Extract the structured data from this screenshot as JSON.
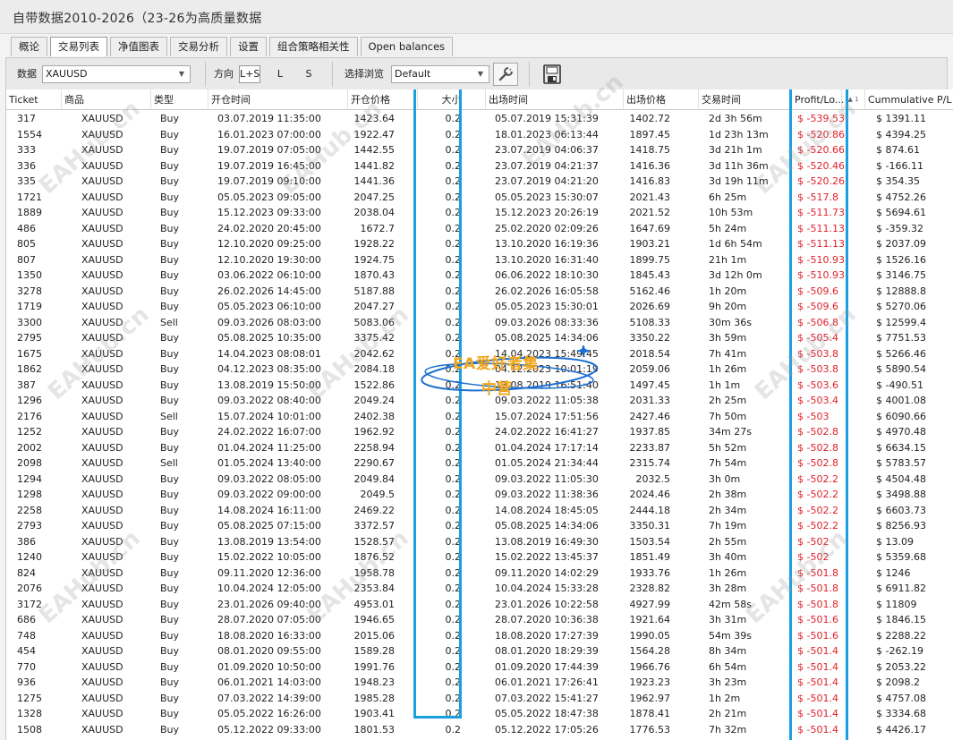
{
  "window": {
    "title": "自带数据2010-2026（23-26为高质量数据"
  },
  "tabs": [
    "概论",
    "交易列表",
    "净值图表",
    "交易分析",
    "设置",
    "组合策略相关性",
    "Open balances"
  ],
  "active_tab": "交易列表",
  "toolbar": {
    "data_label": "数据",
    "symbol_value": "XAUUSD",
    "direction_label": "方向",
    "direction_options": [
      "L+S",
      "L",
      "S"
    ],
    "direction_selected": "L+S",
    "browse_label": "选择浏览",
    "browse_value": "Default",
    "tool_icon": "wrench-icon",
    "export_icon": "csv-export-icon"
  },
  "table": {
    "headers": [
      "Ticket",
      "商品",
      "类型",
      "开仓时间",
      "开仓价格",
      "大小",
      "出场时间",
      "出场价格",
      "交易时间",
      "Profit/Lo...",
      "Cummulative P/L"
    ],
    "sort_marker": "▲ 1",
    "rows": [
      [
        "317",
        "XAUUSD",
        "Buy",
        "03.07.2019 11:35:00",
        "1423.64",
        "0.2",
        "05.07.2019 15:31:39",
        "1402.72",
        "2d 3h 56m",
        "$ -539.53",
        "$ 1391.11"
      ],
      [
        "1554",
        "XAUUSD",
        "Buy",
        "16.01.2023 07:00:00",
        "1922.47",
        "0.2",
        "18.01.2023 06:13:44",
        "1897.45",
        "1d 23h 13m",
        "$ -520.86",
        "$ 4394.25"
      ],
      [
        "333",
        "XAUUSD",
        "Buy",
        "19.07.2019 07:05:00",
        "1442.55",
        "0.2",
        "23.07.2019 04:06:37",
        "1418.75",
        "3d 21h 1m",
        "$ -520.66",
        "$ 874.61"
      ],
      [
        "336",
        "XAUUSD",
        "Buy",
        "19.07.2019 16:45:00",
        "1441.82",
        "0.2",
        "23.07.2019 04:21:37",
        "1416.36",
        "3d 11h 36m",
        "$ -520.46",
        "$ -166.11"
      ],
      [
        "335",
        "XAUUSD",
        "Buy",
        "19.07.2019 09:10:00",
        "1441.36",
        "0.2",
        "23.07.2019 04:21:20",
        "1416.83",
        "3d 19h 11m",
        "$ -520.26",
        "$ 354.35"
      ],
      [
        "1721",
        "XAUUSD",
        "Buy",
        "05.05.2023 09:05:00",
        "2047.25",
        "0.2",
        "05.05.2023 15:30:07",
        "2021.43",
        "6h 25m",
        "$ -517.8",
        "$ 4752.26"
      ],
      [
        "1889",
        "XAUUSD",
        "Buy",
        "15.12.2023 09:33:00",
        "2038.04",
        "0.2",
        "15.12.2023 20:26:19",
        "2021.52",
        "10h 53m",
        "$ -511.73",
        "$ 5694.61"
      ],
      [
        "486",
        "XAUUSD",
        "Buy",
        "24.02.2020 20:45:00",
        "1672.7",
        "0.2",
        "25.02.2020 02:09:26",
        "1647.69",
        "5h 24m",
        "$ -511.13",
        "$ -359.32"
      ],
      [
        "805",
        "XAUUSD",
        "Buy",
        "12.10.2020 09:25:00",
        "1928.22",
        "0.2",
        "13.10.2020 16:19:36",
        "1903.21",
        "1d 6h 54m",
        "$ -511.13",
        "$ 2037.09"
      ],
      [
        "807",
        "XAUUSD",
        "Buy",
        "12.10.2020 19:30:00",
        "1924.75",
        "0.2",
        "13.10.2020 16:31:40",
        "1899.75",
        "21h 1m",
        "$ -510.93",
        "$ 1526.16"
      ],
      [
        "1350",
        "XAUUSD",
        "Buy",
        "03.06.2022 06:10:00",
        "1870.43",
        "0.2",
        "06.06.2022 18:10:30",
        "1845.43",
        "3d 12h 0m",
        "$ -510.93",
        "$ 3146.75"
      ],
      [
        "3278",
        "XAUUSD",
        "Buy",
        "26.02.2026 14:45:00",
        "5187.88",
        "0.2",
        "26.02.2026 16:05:58",
        "5162.46",
        "1h 20m",
        "$ -509.6",
        "$ 12888.8"
      ],
      [
        "1719",
        "XAUUSD",
        "Buy",
        "05.05.2023 06:10:00",
        "2047.27",
        "0.2",
        "05.05.2023 15:30:01",
        "2026.69",
        "9h 20m",
        "$ -509.6",
        "$ 5270.06"
      ],
      [
        "3300",
        "XAUUSD",
        "Sell",
        "09.03.2026 08:03:00",
        "5083.06",
        "0.2",
        "09.03.2026 08:33:36",
        "5108.33",
        "30m 36s",
        "$ -506.8",
        "$ 12599.4"
      ],
      [
        "2795",
        "XAUUSD",
        "Buy",
        "05.08.2025 10:35:00",
        "3375.42",
        "0.2",
        "05.08.2025 14:34:06",
        "3350.22",
        "3h 59m",
        "$ -505.4",
        "$ 7751.53"
      ],
      [
        "1675",
        "XAUUSD",
        "Buy",
        "14.04.2023 08:08:01",
        "2042.62",
        "0.2",
        "14.04.2023 15:49:45",
        "2018.54",
        "7h 41m",
        "$ -503.8",
        "$ 5266.46"
      ],
      [
        "1862",
        "XAUUSD",
        "Buy",
        "04.12.2023 08:35:00",
        "2084.18",
        "0.2",
        "04.12.2023 10:01:19",
        "2059.06",
        "1h 26m",
        "$ -503.8",
        "$ 5890.54"
      ],
      [
        "387",
        "XAUUSD",
        "Buy",
        "13.08.2019 15:50:00",
        "1522.86",
        "0.2",
        "13.08.2019 16:51:40",
        "1497.45",
        "1h 1m",
        "$ -503.6",
        "$ -490.51"
      ],
      [
        "1296",
        "XAUUSD",
        "Buy",
        "09.03.2022 08:40:00",
        "2049.24",
        "0.2",
        "09.03.2022 11:05:38",
        "2031.33",
        "2h 25m",
        "$ -503.4",
        "$ 4001.08"
      ],
      [
        "2176",
        "XAUUSD",
        "Sell",
        "15.07.2024 10:01:00",
        "2402.38",
        "0.2",
        "15.07.2024 17:51:56",
        "2427.46",
        "7h 50m",
        "$ -503",
        "$ 6090.66"
      ],
      [
        "1252",
        "XAUUSD",
        "Buy",
        "24.02.2022 16:07:00",
        "1962.92",
        "0.2",
        "24.02.2022 16:41:27",
        "1937.85",
        "34m 27s",
        "$ -502.8",
        "$ 4970.48"
      ],
      [
        "2002",
        "XAUUSD",
        "Buy",
        "01.04.2024 11:25:00",
        "2258.94",
        "0.2",
        "01.04.2024 17:17:14",
        "2233.87",
        "5h 52m",
        "$ -502.8",
        "$ 6634.15"
      ],
      [
        "2098",
        "XAUUSD",
        "Sell",
        "01.05.2024 13:40:00",
        "2290.67",
        "0.2",
        "01.05.2024 21:34:44",
        "2315.74",
        "7h 54m",
        "$ -502.8",
        "$ 5783.57"
      ],
      [
        "1294",
        "XAUUSD",
        "Buy",
        "09.03.2022 08:05:00",
        "2049.84",
        "0.2",
        "09.03.2022 11:05:30",
        "2032.5",
        "3h 0m",
        "$ -502.2",
        "$ 4504.48"
      ],
      [
        "1298",
        "XAUUSD",
        "Buy",
        "09.03.2022 09:00:00",
        "2049.5",
        "0.2",
        "09.03.2022 11:38:36",
        "2024.46",
        "2h 38m",
        "$ -502.2",
        "$ 3498.88"
      ],
      [
        "2258",
        "XAUUSD",
        "Buy",
        "14.08.2024 16:11:00",
        "2469.22",
        "0.2",
        "14.08.2024 18:45:05",
        "2444.18",
        "2h 34m",
        "$ -502.2",
        "$ 6603.73"
      ],
      [
        "2793",
        "XAUUSD",
        "Buy",
        "05.08.2025 07:15:00",
        "3372.57",
        "0.2",
        "05.08.2025 14:34:06",
        "3350.31",
        "7h 19m",
        "$ -502.2",
        "$ 8256.93"
      ],
      [
        "386",
        "XAUUSD",
        "Buy",
        "13.08.2019 13:54:00",
        "1528.57",
        "0.2",
        "13.08.2019 16:49:30",
        "1503.54",
        "2h 55m",
        "$ -502",
        "$ 13.09"
      ],
      [
        "1240",
        "XAUUSD",
        "Buy",
        "15.02.2022 10:05:00",
        "1876.52",
        "0.2",
        "15.02.2022 13:45:37",
        "1851.49",
        "3h 40m",
        "$ -502",
        "$ 5359.68"
      ],
      [
        "824",
        "XAUUSD",
        "Buy",
        "09.11.2020 12:36:00",
        "1958.78",
        "0.2",
        "09.11.2020 14:02:29",
        "1933.76",
        "1h 26m",
        "$ -501.8",
        "$ 1246"
      ],
      [
        "2076",
        "XAUUSD",
        "Buy",
        "10.04.2024 12:05:00",
        "2353.84",
        "0.2",
        "10.04.2024 15:33:28",
        "2328.82",
        "3h 28m",
        "$ -501.8",
        "$ 6911.82"
      ],
      [
        "3172",
        "XAUUSD",
        "Buy",
        "23.01.2026 09:40:00",
        "4953.01",
        "0.2",
        "23.01.2026 10:22:58",
        "4927.99",
        "42m 58s",
        "$ -501.8",
        "$ 11809"
      ],
      [
        "686",
        "XAUUSD",
        "Buy",
        "28.07.2020 07:05:00",
        "1946.65",
        "0.2",
        "28.07.2020 10:36:38",
        "1921.64",
        "3h 31m",
        "$ -501.6",
        "$ 1846.15"
      ],
      [
        "748",
        "XAUUSD",
        "Buy",
        "18.08.2020 16:33:00",
        "2015.06",
        "0.2",
        "18.08.2020 17:27:39",
        "1990.05",
        "54m 39s",
        "$ -501.6",
        "$ 2288.22"
      ],
      [
        "454",
        "XAUUSD",
        "Buy",
        "08.01.2020 09:55:00",
        "1589.28",
        "0.2",
        "08.01.2020 18:29:39",
        "1564.28",
        "8h 34m",
        "$ -501.4",
        "$ -262.19"
      ],
      [
        "770",
        "XAUUSD",
        "Buy",
        "01.09.2020 10:50:00",
        "1991.76",
        "0.2",
        "01.09.2020 17:44:39",
        "1966.76",
        "6h 54m",
        "$ -501.4",
        "$ 2053.22"
      ],
      [
        "936",
        "XAUUSD",
        "Buy",
        "06.01.2021 14:03:00",
        "1948.23",
        "0.2",
        "06.01.2021 17:26:41",
        "1923.23",
        "3h 23m",
        "$ -501.4",
        "$ 2098.2"
      ],
      [
        "1275",
        "XAUUSD",
        "Buy",
        "07.03.2022 14:39:00",
        "1985.28",
        "0.2",
        "07.03.2022 15:41:27",
        "1962.97",
        "1h 2m",
        "$ -501.4",
        "$ 4757.08"
      ],
      [
        "1328",
        "XAUUSD",
        "Buy",
        "05.05.2022 16:26:00",
        "1903.41",
        "0.2",
        "05.05.2022 18:47:38",
        "1878.41",
        "2h 21m",
        "$ -501.4",
        "$ 3334.68"
      ],
      [
        "1508",
        "XAUUSD",
        "Buy",
        "05.12.2022 09:33:00",
        "1801.53",
        "0.2",
        "05.12.2022 17:05:26",
        "1776.53",
        "7h 32m",
        "$ -501.4",
        "$ 4426.17"
      ]
    ]
  },
  "watermark": {
    "text": "EAHub.cn"
  },
  "logo": {
    "line1": "EA爱好者集",
    "line2": "中营"
  },
  "colors": {
    "highlight": "#1aa0e0",
    "loss": "#e0222b",
    "logo": "#f2a519"
  }
}
